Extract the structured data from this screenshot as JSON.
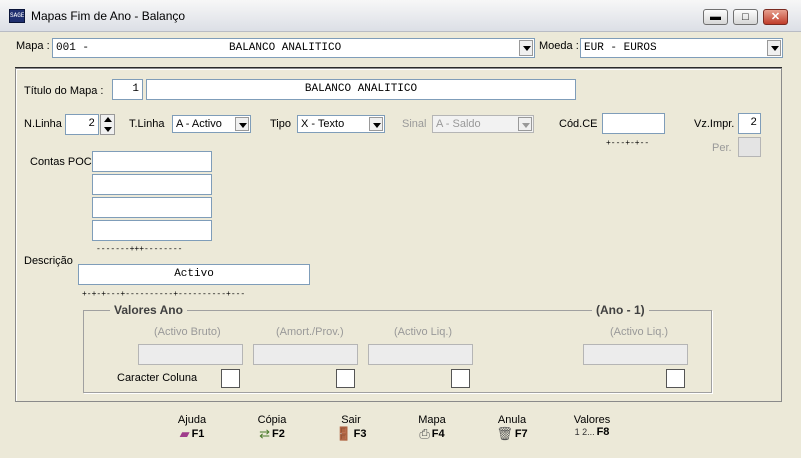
{
  "window": {
    "title": "Mapas Fim de Ano - Balanço",
    "icon_text": "SAGE"
  },
  "controls": {
    "minimize": "▬",
    "maximize": "□",
    "close": "✕"
  },
  "header": {
    "mapa_label": "Mapa :",
    "mapa_code": "001  -",
    "mapa_name": "BALANCO ANALITICO",
    "moeda_label": "Moeda :",
    "moeda_value": "EUR - EUROS"
  },
  "form": {
    "titulo_label": "Título do Mapa :",
    "titulo_num": "1",
    "titulo_value": "BALANCO ANALITICO",
    "nlinha_label": "N.Linha",
    "nlinha_value": "2",
    "tlinha_label": "T.Linha",
    "tlinha_value": "A - Activo",
    "tipo_label": "Tipo",
    "tipo_value": "X - Texto",
    "sinal_label": "Sinal",
    "sinal_value": "A - Saldo",
    "codce_label": "Cód.CE",
    "codce_value": "",
    "codce_mask": "+---+-+--",
    "vzimpr_label": "Vz.Impr.",
    "vzimpr_value": "2",
    "per_label": "Per.",
    "contas_label": "Contas POC",
    "contas_values": [
      "",
      "",
      "",
      ""
    ],
    "contas_mask": "-------+++--------",
    "descricao_label": "Descrição",
    "descricao_value": "Activo",
    "descricao_mask": "+-+-+---+----------+----------+---"
  },
  "valores": {
    "title": "Valores Ano",
    "title_prev": "(Ano - 1)",
    "col1": "(Activo Bruto)",
    "col2": "(Amort./Prov.)",
    "col3": "(Activo Liq.)",
    "col4": "(Activo Liq.)",
    "caracter_label": "Caracter Coluna"
  },
  "fkeys": [
    {
      "label": "Ajuda",
      "key": "F1",
      "icon": "book-icon"
    },
    {
      "label": "Cópia",
      "key": "F2",
      "icon": "copy-icon"
    },
    {
      "label": "Sair",
      "key": "F3",
      "icon": "exit-icon"
    },
    {
      "label": "Mapa",
      "key": "F4",
      "icon": "printer-icon"
    },
    {
      "label": "Anula",
      "key": "F7",
      "icon": "trash-icon"
    },
    {
      "label": "Valores",
      "key": "F8",
      "icon": "sequence-icon",
      "icon_text": "1 2..."
    }
  ]
}
